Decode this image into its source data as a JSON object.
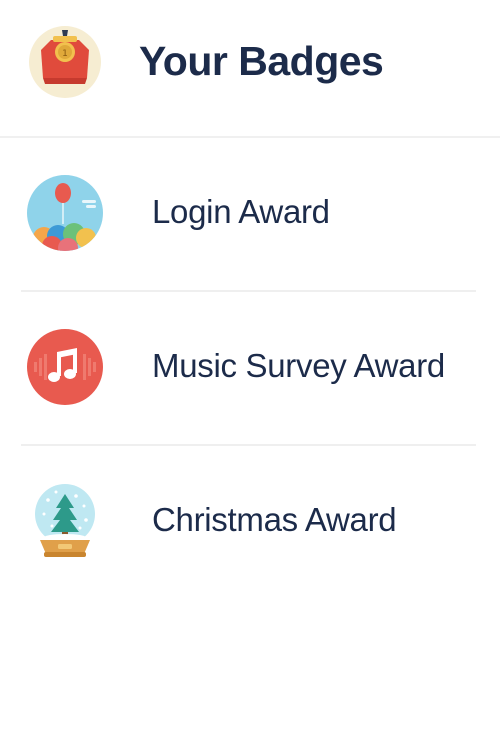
{
  "header": {
    "icon": "medal-badge-icon",
    "title": "Your Badges"
  },
  "badges": [
    {
      "label": "Login Award",
      "icon": "balloons-icon",
      "color": "#8fd3ea"
    },
    {
      "label": "Music Survey Award",
      "icon": "music-note-icon",
      "color": "#e85a4f"
    },
    {
      "label": "Christmas Award",
      "icon": "snow-globe-icon",
      "color": "#bfe8f2"
    }
  ],
  "colors": {
    "text": "#1c2b4a",
    "divider": "#efefef",
    "background": "#ffffff"
  }
}
